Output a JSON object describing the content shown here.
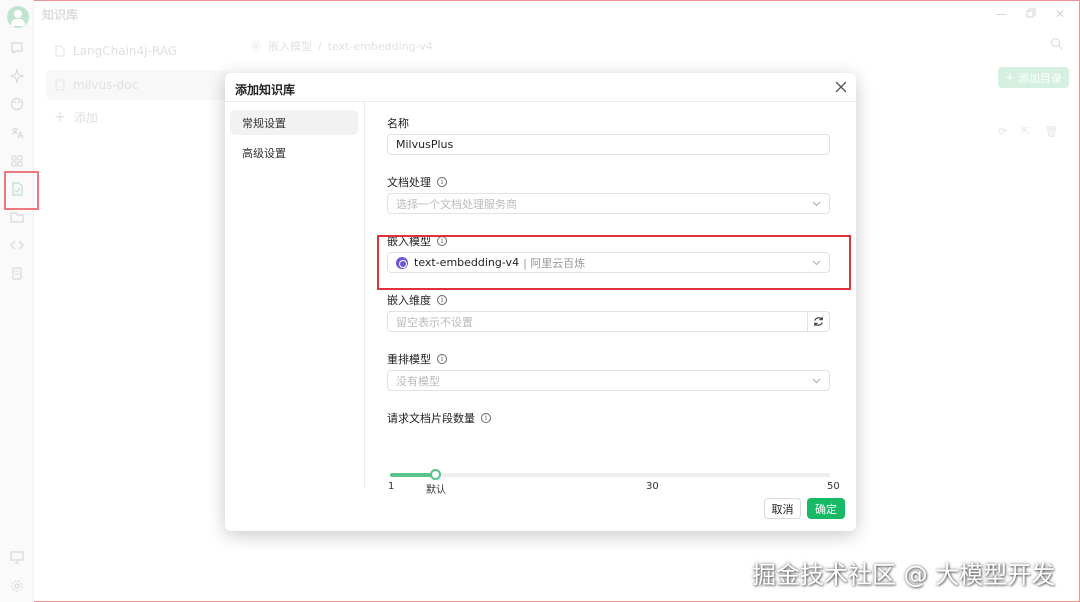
{
  "app": {
    "title": "知识库"
  },
  "knowledge_bases": [
    {
      "name": "LangChain4j-RAG",
      "active": false
    },
    {
      "name": "milvus-doc",
      "active": true
    }
  ],
  "kb_add_label": "添加",
  "breadcrumb": {
    "part1": "嵌入模型",
    "part2": "text-embedding-v4"
  },
  "add_directory_label": "添加目录",
  "modal": {
    "title": "添加知识库",
    "tabs": [
      {
        "label": "常规设置",
        "active": true
      },
      {
        "label": "高级设置",
        "active": false
      }
    ],
    "fields": {
      "name": {
        "label": "名称",
        "value": "MilvusPlus"
      },
      "doc_processing": {
        "label": "文档处理",
        "placeholder": "选择一个文档处理服务商"
      },
      "embedding_model": {
        "label": "嵌入模型",
        "model": "text-embedding-v4",
        "provider": "| 阿里云百炼"
      },
      "embedding_dim": {
        "label": "嵌入维度",
        "placeholder": "留空表示不设置"
      },
      "rerank_model": {
        "label": "重排模型",
        "placeholder": "没有模型"
      },
      "doc_chunks": {
        "label": "请求文档片段数量",
        "min_label": "1",
        "default_label": "默认",
        "mid_label": "30",
        "max_label": "50",
        "min": 1,
        "max": 50,
        "value": 6
      }
    },
    "cancel_label": "取消",
    "ok_label": "确定"
  },
  "watermark": "掘金技术社区 @ 大模型开发",
  "colors": {
    "accent": "#18b965",
    "slider": "#58c38a",
    "highlight": "#e0323a",
    "model_chip": "#6a56d9"
  }
}
